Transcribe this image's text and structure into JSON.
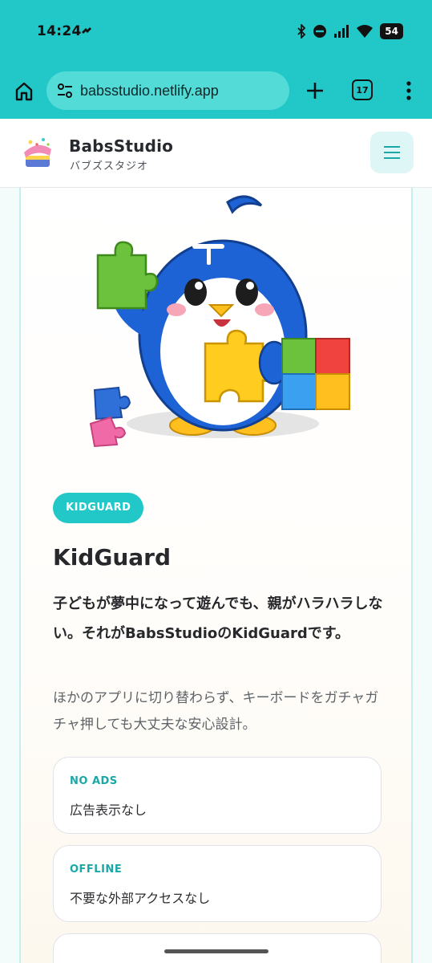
{
  "status": {
    "time": "14:24",
    "battery": "54"
  },
  "browser": {
    "url": "babsstudio.netlify.app",
    "tab_count": "17"
  },
  "header": {
    "brand_name": "BabsStudio",
    "brand_sub": "バブズスタジオ"
  },
  "product": {
    "badge": "KIDGUARD",
    "title": "KidGuard",
    "lead": "子どもが夢中になって遊んでも、親がハラハラしない。それがBabsStudioのKidGuardです。",
    "description": "ほかのアプリに切り替わらず、キーボードをガチャガチャ押しても大丈夫な安心設計。",
    "features": [
      {
        "label": "NO ADS",
        "text": "広告表示なし"
      },
      {
        "label": "OFFLINE",
        "text": "不要な外部アクセスなし"
      }
    ]
  },
  "colors": {
    "accent": "#22c7c7",
    "accent_text": "#1ba7a7"
  }
}
